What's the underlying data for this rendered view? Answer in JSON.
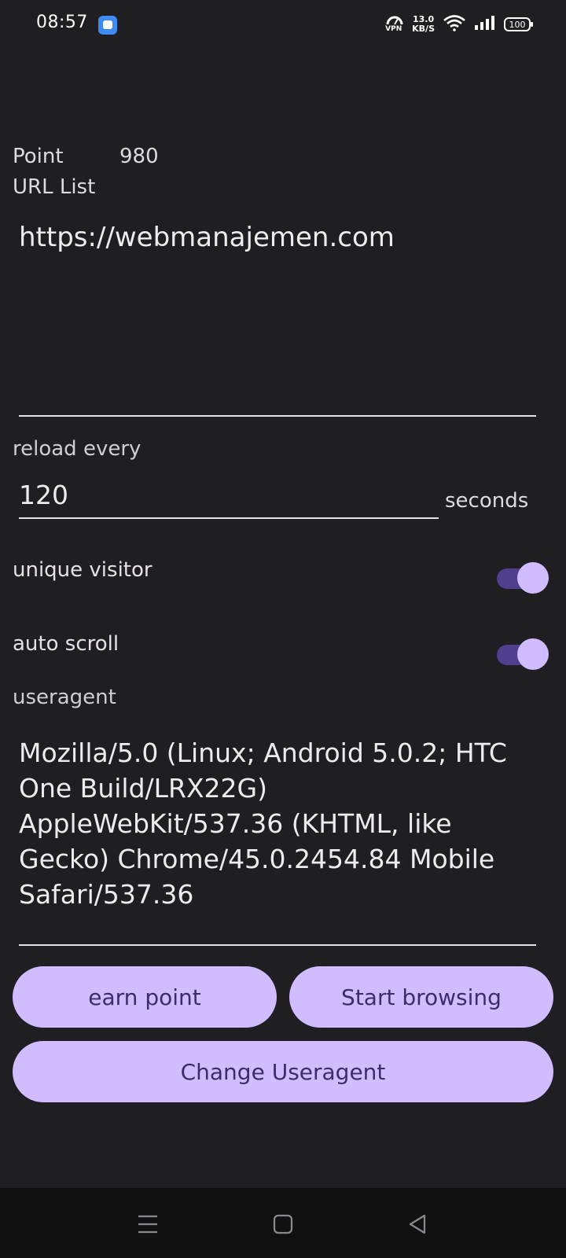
{
  "status_bar": {
    "time": "08:57",
    "app_icon": "app-notification-icon",
    "vpn_label": "VPN",
    "net_speed_value": "13.0",
    "net_speed_unit": "KB/S",
    "battery": "100"
  },
  "point": {
    "label": "Point",
    "value": "980"
  },
  "url_list": {
    "label": "URL List",
    "value": "https://webmanajemen.com"
  },
  "reload": {
    "label": "reload every",
    "value": "120",
    "unit": "seconds"
  },
  "toggles": {
    "unique_visitor": {
      "label": "unique visitor",
      "on": true
    },
    "auto_scroll": {
      "label": "auto scroll",
      "on": true
    }
  },
  "useragent": {
    "label": "useragent",
    "value": "Mozilla/5.0 (Linux; Android 5.0.2; HTC One Build/LRX22G) AppleWebKit/537.36 (KHTML, like Gecko) Chrome/45.0.2454.84 Mobile Safari/537.36"
  },
  "buttons": {
    "earn_point": "earn point",
    "start_browsing": "Start browsing",
    "change_useragent": "Change Useragent"
  },
  "colors": {
    "background": "#1f1f23",
    "button_bg": "#d1bcff",
    "button_text": "#3a2c6e",
    "toggle_track": "#4f3f8e",
    "toggle_thumb": "#d1bcff",
    "nav_bar": "#111112"
  },
  "nav_bar": {
    "menu_icon": "recent-apps-icon",
    "home_icon": "home-icon",
    "back_icon": "back-icon"
  }
}
